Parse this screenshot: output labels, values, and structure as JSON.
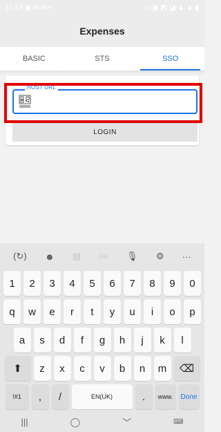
{
  "status": {
    "time": "11:13",
    "left_icons": "▣ ✉ ✉ •",
    "right_icons": "▭ ▣ ◩ ◪ ▲ ▲ ▮"
  },
  "app": {
    "title": "Expenses"
  },
  "tabs": [
    {
      "label": "BASIC",
      "active": false
    },
    {
      "label": "STS",
      "active": false
    },
    {
      "label": "SSO",
      "active": true
    }
  ],
  "form": {
    "host_label": "HOST URL",
    "host_value": "",
    "login_label": "LOGIN"
  },
  "keyboard": {
    "toolbar": [
      "(↻)",
      "☻",
      "▤",
      "GIF",
      "🎙",
      "⚙",
      "···"
    ],
    "row1": [
      "1",
      "2",
      "3",
      "4",
      "5",
      "6",
      "7",
      "8",
      "9",
      "0"
    ],
    "row2": [
      "q",
      "w",
      "e",
      "r",
      "t",
      "y",
      "u",
      "i",
      "o",
      "p"
    ],
    "row3": [
      "a",
      "s",
      "d",
      "f",
      "g",
      "h",
      "j",
      "k",
      "l"
    ],
    "row4": [
      "⬆",
      "z",
      "x",
      "c",
      "v",
      "b",
      "n",
      "m",
      "⌫"
    ],
    "row5": [
      "!#1",
      ",",
      "/",
      "EN(UK)",
      ".",
      "www.",
      "Done"
    ],
    "nav": [
      "|||",
      "◯",
      "﹀",
      "⌨"
    ]
  },
  "colors": {
    "accent": "#1a73e8",
    "highlight": "#e00000"
  }
}
